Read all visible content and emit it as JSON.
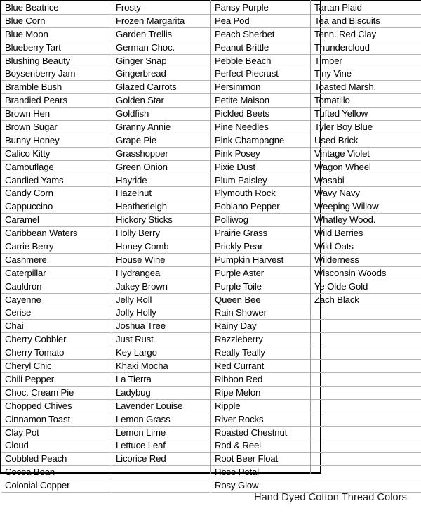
{
  "document": {
    "caption": "Hand Dyed Cotton Thread Colors",
    "grid": {
      "row_count": 35,
      "column_count": 4,
      "border_color": "#000000",
      "rule_color": "#b6b6b6",
      "text_color": "#000000",
      "background": "#ffffff"
    }
  },
  "columns": [
    {
      "name": "column-1",
      "items": [
        "Blue Beatrice",
        "Blue Corn",
        "Blue Moon",
        "Blueberry Tart",
        "Blushing Beauty",
        "Boysenberry Jam",
        "Bramble Bush",
        "Brandied Pears",
        "Brown Hen",
        "Brown Sugar",
        "Bunny Honey",
        "Calico Kitty",
        "Camouflage",
        "Candied Yams",
        "Candy Corn",
        "Cappuccino",
        "Caramel",
        "Caribbean Waters",
        "Carrie Berry",
        "Cashmere",
        "Caterpillar",
        "Cauldron",
        "Cayenne",
        "Cerise",
        "Chai",
        "Cherry Cobbler",
        "Cherry Tomato",
        "Cheryl Chic",
        "Chili Pepper",
        "Choc. Cream Pie",
        "Chopped Chives",
        "Cinnamon Toast",
        "Clay Pot",
        "Cloud",
        "Cobbled Peach",
        "Cocoa Bean",
        "Colonial Copper"
      ]
    },
    {
      "name": "column-2",
      "items": [
        "Frosty",
        "Frozen Margarita",
        "Garden Trellis",
        "German Choc.",
        "Ginger Snap",
        "Gingerbread",
        "Glazed Carrots",
        "Golden Star",
        "Goldfish",
        "Granny Annie",
        "Grape Pie",
        "Grasshopper",
        "Green Onion",
        "Hayride",
        "Hazelnut",
        "Heatherleigh",
        "Hickory Sticks",
        "Holly Berry",
        "Honey Comb",
        "House Wine",
        "Hydrangea",
        "Jakey Brown",
        "Jelly Roll",
        "Jolly Holly",
        "Joshua Tree",
        "Just Rust",
        "Key Largo",
        "Khaki Mocha",
        "La Tierra",
        "Ladybug",
        "Lavender Louise",
        "Lemon Grass",
        "Lemon Lime",
        "Lettuce Leaf",
        "Licorice Red",
        "",
        ""
      ]
    },
    {
      "name": "column-3",
      "items": [
        "Pansy Purple",
        "Pea Pod",
        "Peach Sherbet",
        "Peanut Brittle",
        "Pebble Beach",
        "Perfect Piecrust",
        "Persimmon",
        "Petite Maison",
        "Pickled Beets",
        "Pine Needles",
        "Pink Champagne",
        "Pink Posey",
        "Pixie Dust",
        "Plum Paisley",
        "Plymouth Rock",
        "Poblano Pepper",
        "Polliwog",
        "Prairie Grass",
        "Prickly Pear",
        "Pumpkin Harvest",
        "Purple Aster",
        "Purple Toile",
        "Queen Bee",
        "Rain Shower",
        "Rainy Day",
        "Razzleberry",
        "Really Teally",
        "Red Currant",
        "Ribbon Red",
        "Ripe Melon",
        "Ripple",
        "River Rocks",
        "Roasted Chestnut",
        "Rod & Reel",
        "Root Beer Float",
        "Rose Petal",
        "Rosy Glow"
      ]
    },
    {
      "name": "column-4",
      "items": [
        "Tartan Plaid",
        "Tea and Biscuits",
        "Tenn.  Red Clay",
        "Thundercloud",
        "Timber",
        "Tiny Vine",
        "Toasted Marsh.",
        "Tomatillo",
        "Tufted Yellow",
        "Tyler Boy Blue",
        "Used Brick",
        "Vintage Violet",
        "Wagon Wheel",
        "Wasabi",
        "Wavy Navy",
        "Weeping Willow",
        "Whatley Wood.",
        "Wild Berries",
        "Wild Oats",
        "Wilderness",
        "Wisconsin Woods",
        "Ye Olde Gold",
        "Zach Black",
        "",
        "",
        "",
        "",
        "",
        "",
        "",
        "",
        "",
        "",
        "",
        "",
        "",
        ""
      ]
    }
  ]
}
